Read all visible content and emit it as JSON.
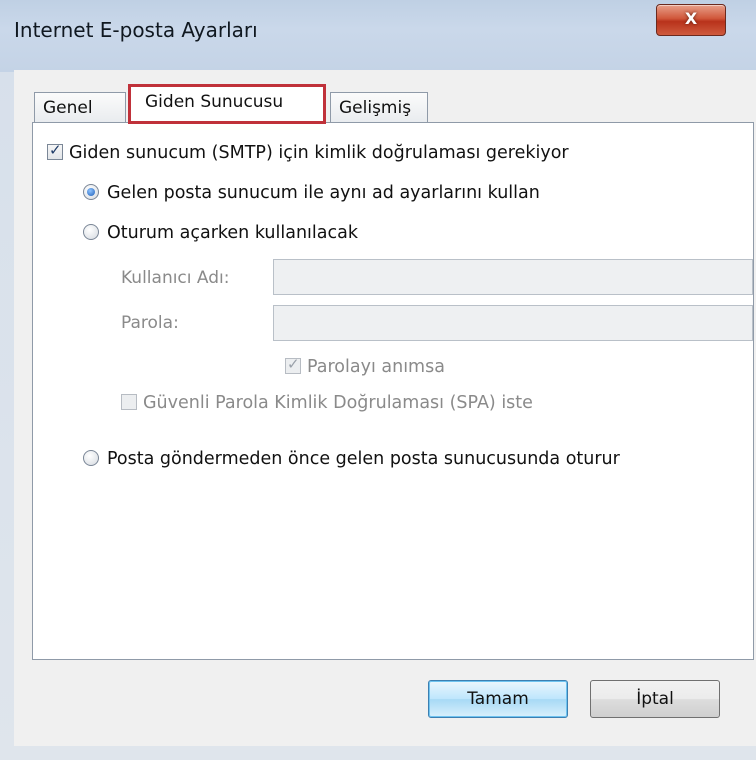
{
  "window": {
    "title": "Internet E-posta Ayarları",
    "close_label": "X"
  },
  "tabs": [
    {
      "label": "Genel"
    },
    {
      "label": "Giden Sunucusu"
    },
    {
      "label": "Gelişmiş"
    }
  ],
  "outgoing": {
    "auth_required_label": "Giden sunucum (SMTP) için kimlik doğrulaması gerekiyor",
    "auth_required_checked": true,
    "option_same_label": "Gelen posta sunucum ile aynı ad ayarlarını kullan",
    "option_login_label": "Oturum açarken kullanılacak",
    "username_label": "Kullanıcı Adı:",
    "username_value": "",
    "password_label": "Parola:",
    "password_value": "",
    "remember_password_label": "Parolayı anımsa",
    "remember_password_checked": true,
    "spa_label": "Güvenli Parola Kimlik Doğrulaması (SPA) iste",
    "spa_checked": false,
    "option_pop_before_label": "Posta göndermeden önce gelen posta sunucusunda oturur",
    "selected_option": "same"
  },
  "buttons": {
    "ok_label": "Tamam",
    "cancel_label": "İptal"
  },
  "colors": {
    "highlight_border": "#c0313a",
    "close_button": "#c94a2f"
  }
}
